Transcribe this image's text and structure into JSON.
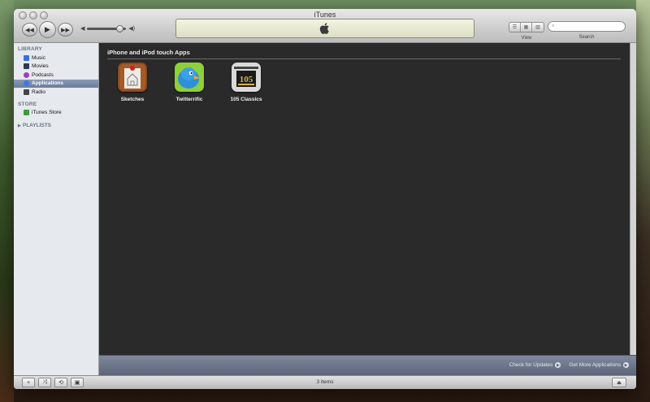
{
  "window": {
    "title": "iTunes"
  },
  "toolbar": {
    "view_label": "View",
    "search_label": "Search",
    "search_placeholder": ""
  },
  "sidebar": {
    "library_heading": "LIBRARY",
    "library_items": [
      {
        "label": "Music",
        "icon": "music-note-icon",
        "color": "#3a6fd8"
      },
      {
        "label": "Movies",
        "icon": "film-icon",
        "color": "#2f3a4f"
      },
      {
        "label": "Podcasts",
        "icon": "podcast-icon",
        "color": "#9b3fbf"
      },
      {
        "label": "Applications",
        "icon": "app-store-icon",
        "color": "#3b7ae0",
        "selected": true
      },
      {
        "label": "Radio",
        "icon": "radio-antenna-icon",
        "color": "#444444"
      }
    ],
    "store_heading": "STORE",
    "store_items": [
      {
        "label": "iTunes Store",
        "icon": "store-icon",
        "color": "#3d9a3d"
      }
    ],
    "playlists_heading": "PLAYLISTS"
  },
  "main": {
    "section_title": "iPhone and iPod touch Apps",
    "apps": [
      {
        "name": "Sketches",
        "icon": "sketches-app-icon"
      },
      {
        "name": "Twitterrific",
        "icon": "twitterrific-app-icon"
      },
      {
        "name": "105 Classics",
        "icon": "105-classics-app-icon",
        "badge_text": "105"
      }
    ],
    "footer": {
      "check_updates": "Check for Updates",
      "get_more": "Get More Applications"
    }
  },
  "statusbar": {
    "items_count": "3 items"
  },
  "colors": {
    "content_bg": "#2a2a2a",
    "sidebar_bg": "#e6e9ee",
    "selection": "#7486a6",
    "footer_bar": "#6e7789"
  }
}
